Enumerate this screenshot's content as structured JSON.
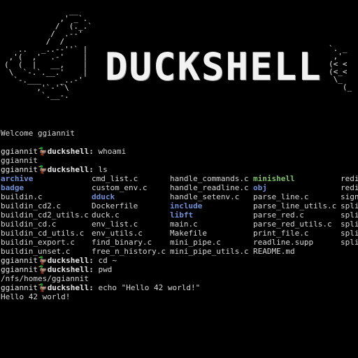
{
  "banner": {
    "duck_left_art": "              __\n            ,' _`.\n           /  (._.`\n          /  .--'\n         /  /\n   ..   _..--''` |\n ,'(  ,'  .-'    |\n(  (  |   __,    |\n \\  `-.`.__.'    |\n  `-.___    _..-'\n       ,'`-'`\\\n        `.__-.",
    "duck_right_art": "`. _\n ,'\n(< <\n(<_<\n \\_\n   (_",
    "logo_text": "DUCKSHELL"
  },
  "terminal": {
    "welcome": "Welcome ggiannit",
    "prompt_user": "ggiannit",
    "prompt_emoji": "🦆",
    "prompt_host": "duckshell",
    "prompt_sep": ":",
    "history": [
      {
        "cmd": "whoami",
        "output": [
          "ggiannit"
        ]
      },
      {
        "cmd": "ls"
      },
      {
        "cmd": "cd ~",
        "output": []
      },
      {
        "cmd": "pwd",
        "output": [
          "/nfs/homes/ggiannit"
        ]
      },
      {
        "cmd": "echo \"Hello 42 world!\"",
        "output": [
          "Hello 42 world!"
        ]
      }
    ],
    "ls_rows": [
      [
        {
          "t": "archive",
          "k": "dir"
        },
        {
          "t": "cmd_list.c"
        },
        {
          "t": "handle_commands.c"
        },
        {
          "t": "minishell",
          "k": "exe"
        },
        {
          "t": "redi"
        }
      ],
      [
        {
          "t": "badge",
          "k": "dir"
        },
        {
          "t": "custom_env.c"
        },
        {
          "t": "handle_readline.c"
        },
        {
          "t": "obj",
          "k": "dir"
        },
        {
          "t": "redi"
        }
      ],
      [
        {
          "t": "buildin.c"
        },
        {
          "t": "dduck",
          "k": "dir"
        },
        {
          "t": "handle_setenv.c"
        },
        {
          "t": "parse_line.c"
        },
        {
          "t": "sign"
        }
      ],
      [
        {
          "t": "buildin_cd2.c"
        },
        {
          "t": "Dockerfile"
        },
        {
          "t": "include",
          "k": "dir"
        },
        {
          "t": "parse_line_utils.c"
        },
        {
          "t": "spli"
        }
      ],
      [
        {
          "t": "buildin_cd2_utils.c"
        },
        {
          "t": "duck.c"
        },
        {
          "t": "libft",
          "k": "dir"
        },
        {
          "t": "parse_red.c"
        },
        {
          "t": "spli"
        }
      ],
      [
        {
          "t": "buildin_cd.c"
        },
        {
          "t": "env_list.c"
        },
        {
          "t": "main.c"
        },
        {
          "t": "parse_red_utils.c"
        },
        {
          "t": "spli"
        }
      ],
      [
        {
          "t": "buildin_cd_utils.c"
        },
        {
          "t": "env_utils.c"
        },
        {
          "t": "Makefile"
        },
        {
          "t": "print_file.c"
        },
        {
          "t": "spli"
        }
      ],
      [
        {
          "t": "buildin_export.c"
        },
        {
          "t": "find_binary.c"
        },
        {
          "t": "mini_pipe.c"
        },
        {
          "t": "readline.supp"
        },
        {
          "t": "spli"
        }
      ],
      [
        {
          "t": "buildin_unset.c"
        },
        {
          "t": "free_n_history.c"
        },
        {
          "t": "mini_pipe_utils.c"
        },
        {
          "t": "README.md"
        },
        {
          "t": ""
        }
      ]
    ],
    "current_input": ""
  },
  "colors": {
    "background": "#000000",
    "text": "#d8d8d8",
    "directory": "#6e8fd6",
    "executable": "#7ec26a"
  }
}
